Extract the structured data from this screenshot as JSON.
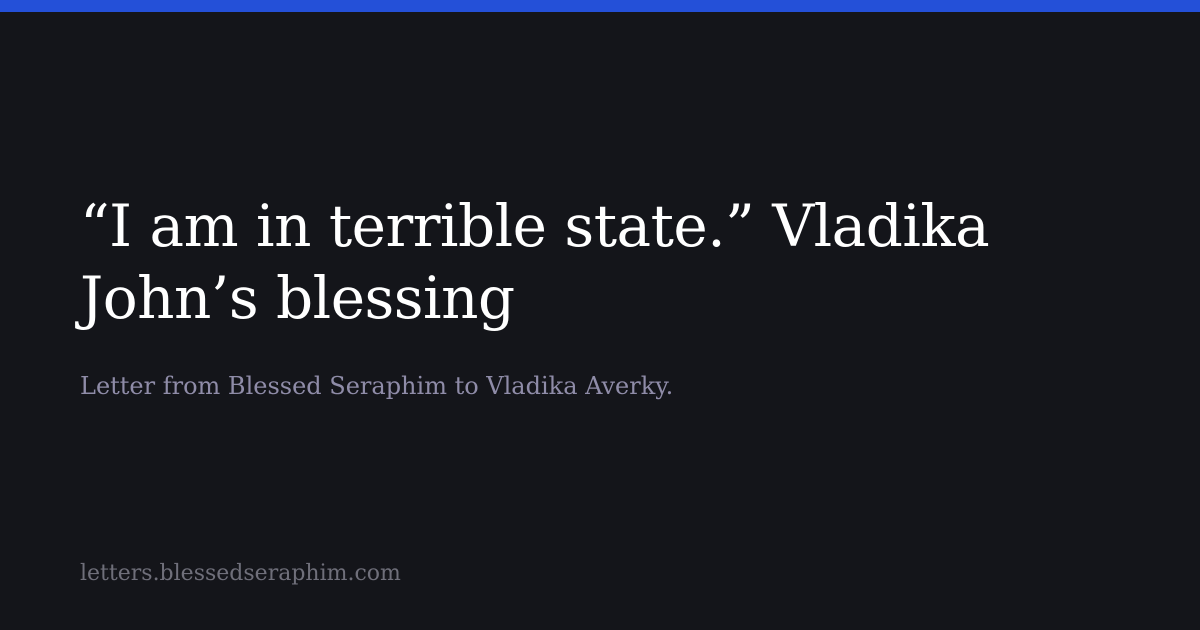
{
  "colors": {
    "background": "#14151a",
    "accent_bar": "#2450d8",
    "title": "#ffffff",
    "subtitle": "#8f8ca8",
    "url": "#6f6f7a"
  },
  "card": {
    "title": "“I am in terrible state.” Vladika John’s blessing",
    "subtitle": "Letter from Blessed Seraphim to Vladika Averky.",
    "site_url": "letters.blessedseraphim.com"
  }
}
